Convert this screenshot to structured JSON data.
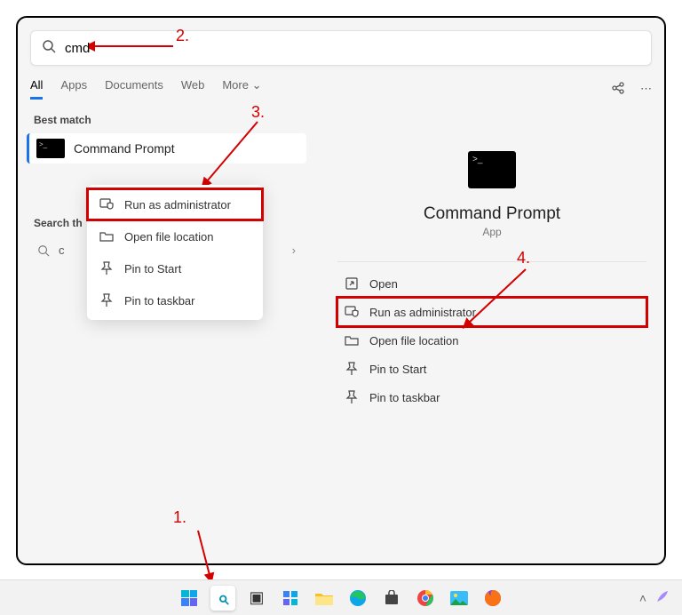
{
  "search": {
    "value": "cmd"
  },
  "tabs": [
    "All",
    "Apps",
    "Documents",
    "Web",
    "More"
  ],
  "active_tab": "All",
  "section_best_match": "Best match",
  "result": {
    "title": "Command Prompt"
  },
  "section_search_web": "Search th",
  "web_query": "c",
  "context_menu": [
    {
      "label": "Run as administrator",
      "icon": "shield-app-icon",
      "highlighted": true
    },
    {
      "label": "Open file location",
      "icon": "folder-icon"
    },
    {
      "label": "Pin to Start",
      "icon": "pin-icon"
    },
    {
      "label": "Pin to taskbar",
      "icon": "pin-icon"
    }
  ],
  "right_pane": {
    "title": "Command Prompt",
    "subtitle": "App",
    "actions": [
      {
        "label": "Open",
        "icon": "open-icon"
      },
      {
        "label": "Run as administrator",
        "icon": "shield-app-icon",
        "highlighted": true
      },
      {
        "label": "Open file location",
        "icon": "folder-icon"
      },
      {
        "label": "Pin to Start",
        "icon": "pin-icon"
      },
      {
        "label": "Pin to taskbar",
        "icon": "pin-icon"
      }
    ]
  },
  "taskbar": [
    "start",
    "search",
    "taskview",
    "widgets",
    "explorer",
    "edge",
    "store",
    "chrome",
    "photos",
    "firefox"
  ],
  "annotations": {
    "a1": "1.",
    "a2": "2.",
    "a3": "3.",
    "a4": "4."
  }
}
